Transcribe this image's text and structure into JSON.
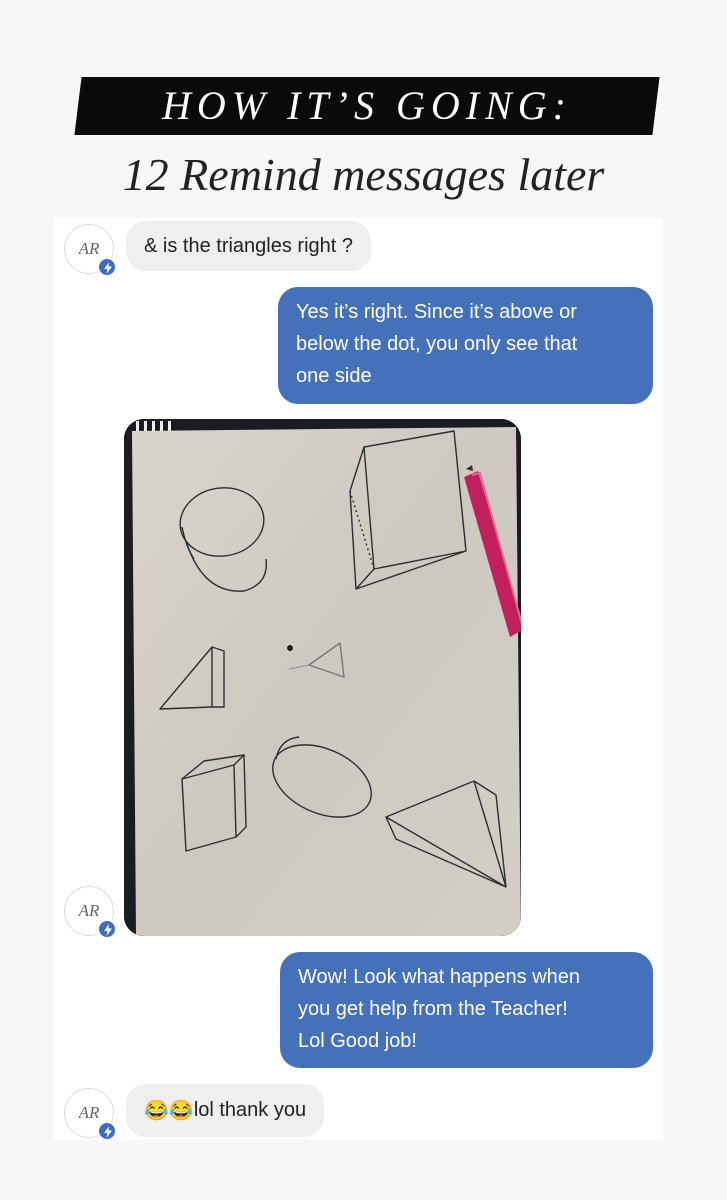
{
  "header": {
    "title": "HOW IT’S GOING:",
    "subtitle": "12 Remind messages later"
  },
  "messages": [
    {
      "sender": "AR",
      "direction": "incoming",
      "text": "& is the triangles right ?"
    },
    {
      "sender": "me",
      "direction": "outgoing",
      "lines": [
        "Yes it’s right. Since it’s above or",
        "below the dot, you only see that",
        "one side"
      ]
    },
    {
      "sender": "AR",
      "direction": "incoming",
      "type": "image",
      "image_alt": "photo of pencil drawings of 3D shapes around a dot"
    },
    {
      "sender": "me",
      "direction": "outgoing",
      "lines": [
        "Wow! Look what happens when",
        "you get help from the Teacher!",
        "Lol Good job!"
      ]
    },
    {
      "sender": "AR",
      "direction": "incoming",
      "emoji": "😂😂",
      "text": "lol thank you"
    }
  ],
  "avatar": {
    "initials": "AR",
    "badge_icon": "lightning-bolt-icon"
  },
  "colors": {
    "outgoing_bubble": "#4471ba",
    "incoming_bubble": "#efefef",
    "badge": "#3a6ebf",
    "banner": "#0a0a0a"
  }
}
